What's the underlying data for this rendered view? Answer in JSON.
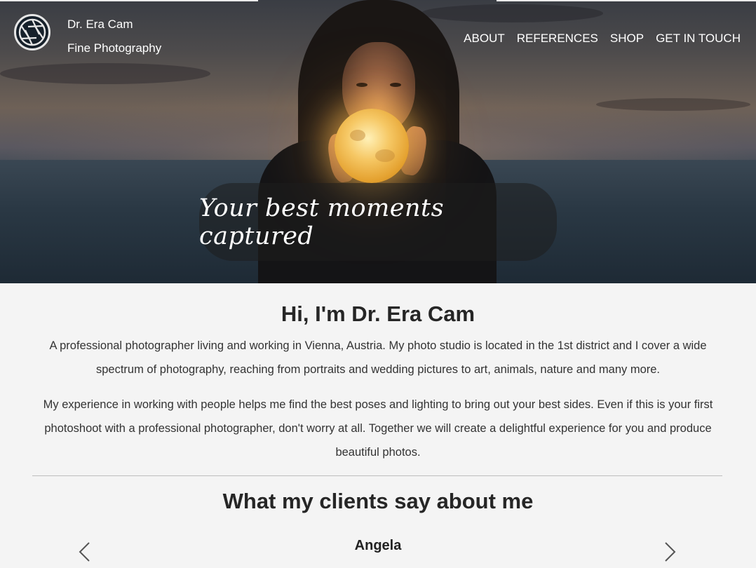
{
  "header": {
    "brand_name": "Dr. Era Cam",
    "brand_sub": "Fine Photography",
    "logo_icon": "camera-aperture-icon",
    "nav": [
      {
        "label": "ABOUT"
      },
      {
        "label": "REFERENCES"
      },
      {
        "label": "SHOP"
      },
      {
        "label": "GET IN TOUCH"
      }
    ]
  },
  "hero": {
    "tagline": "Your best moments captured"
  },
  "about": {
    "title": "Hi, I'm Dr. Era Cam",
    "paragraph1": "A professional photographer living and working in Vienna, Austria. My photo studio is located in the 1st district and I cover a wide spectrum of photography, reaching from portraits and wedding pictures to art, animals, nature and many more.",
    "paragraph2": "My experience in working with people helps me find the best poses and lighting to bring out your best sides. Even if this is your first photoshoot with a professional photographer, don't worry at all. Together we will create a delightful experience for you and produce beautiful photos."
  },
  "testimonials": {
    "title": "What my clients say about me",
    "current_client": "Angela",
    "prev_icon": "chevron-left-icon",
    "next_icon": "chevron-right-icon"
  },
  "colors": {
    "background": "#f4f4f4",
    "text": "#262626",
    "nav_text": "#ffffff"
  }
}
